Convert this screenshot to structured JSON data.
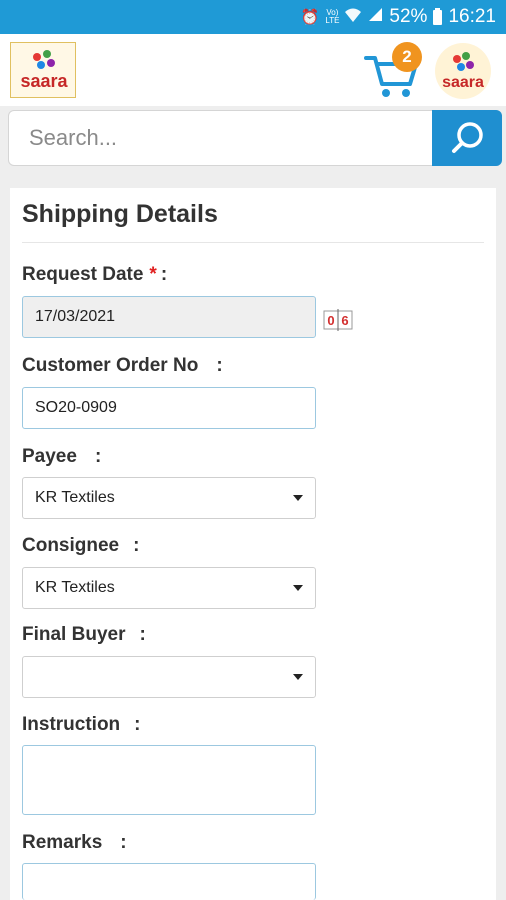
{
  "status_bar": {
    "volte": "Vol) LTE",
    "battery": "52%",
    "time": "16:21"
  },
  "header": {
    "logo_text": "saara",
    "cart_count": "2",
    "avatar_text": "saara"
  },
  "search": {
    "placeholder": "Search..."
  },
  "form": {
    "title": "Shipping Details",
    "request_date_label": "Request Date",
    "request_date_required": "*",
    "request_date_colon": ":",
    "request_date_value": "17/03/2021",
    "calendar_icon_text": "0 6",
    "customer_order_label": "Customer Order No",
    "customer_order_colon": ":",
    "customer_order_value": "SO20-0909",
    "payee_label": "Payee",
    "payee_colon": ":",
    "payee_value": "KR Textiles",
    "consignee_label": "Consignee",
    "consignee_colon": ":",
    "consignee_value": "KR Textiles",
    "final_buyer_label": "Final Buyer",
    "final_buyer_colon": ":",
    "final_buyer_value": "",
    "instruction_label": "Instruction",
    "instruction_colon": ":",
    "remarks_label": "Remarks",
    "remarks_colon": ":"
  },
  "colors": {
    "status_bar": "#1f9ad6",
    "search_button": "#1f8fd0",
    "badge": "#f0941f",
    "required_star": "#e02020",
    "cart_icon": "#2196d6"
  },
  "icons": [
    "alarm-icon",
    "volte-icon",
    "wifi-icon",
    "signal-icon",
    "battery-icon",
    "cart-icon",
    "search-icon",
    "calendar-icon",
    "dropdown-caret-icon"
  ]
}
